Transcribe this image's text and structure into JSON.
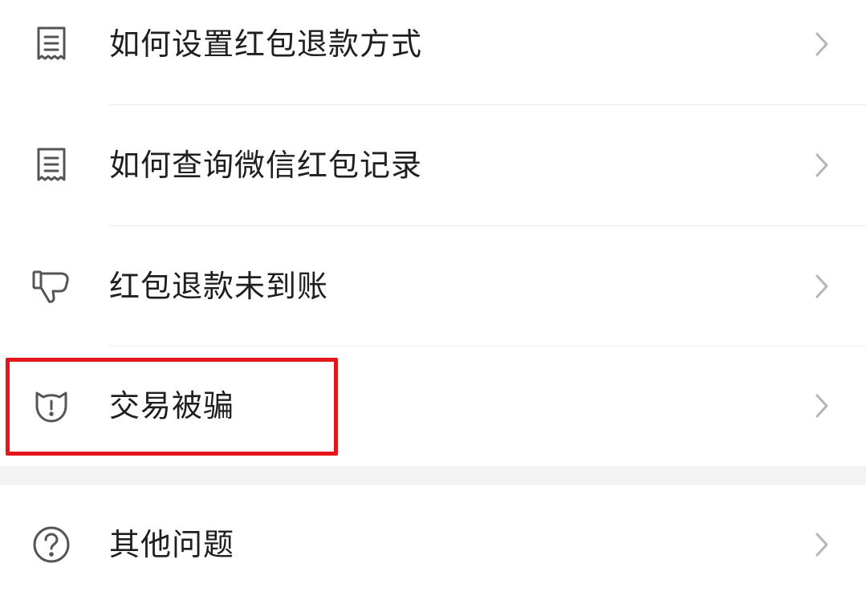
{
  "menu": {
    "items": [
      {
        "label": "如何设置红包退款方式",
        "icon": "receipt-icon"
      },
      {
        "label": "如何查询微信红包记录",
        "icon": "receipt-icon"
      },
      {
        "label": "红包退款未到账",
        "icon": "thumbs-down-icon"
      },
      {
        "label": "交易被骗",
        "icon": "alert-cat-icon"
      }
    ],
    "other": {
      "label": "其他问题",
      "icon": "question-icon"
    }
  },
  "colors": {
    "highlight": "#e4161c",
    "text": "#1f1f1f",
    "icon": "#555555",
    "chevron": "#b5b5b5",
    "background": "#f3f3f3"
  }
}
